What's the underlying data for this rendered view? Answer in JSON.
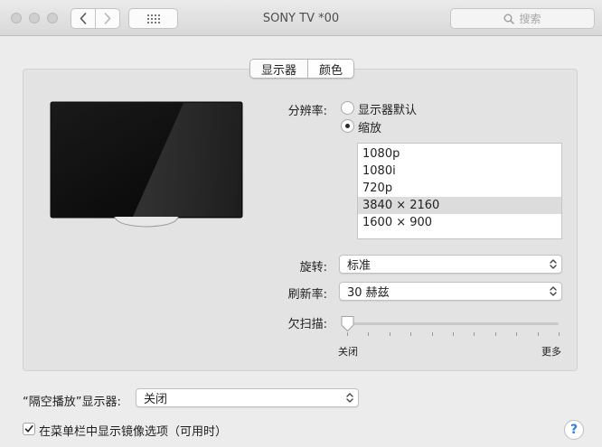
{
  "window": {
    "title": "SONY TV  *00",
    "search_placeholder": "搜索"
  },
  "tabs": [
    {
      "label": "显示器",
      "selected": true
    },
    {
      "label": "颜色",
      "selected": false
    }
  ],
  "resolution": {
    "label": "分辨率:",
    "options": [
      {
        "label": "显示器默认",
        "checked": false
      },
      {
        "label": "缩放",
        "checked": true
      }
    ],
    "list": [
      "1080p",
      "1080i",
      "720p",
      "3840 × 2160",
      "1600 × 900"
    ],
    "selected": "3840 × 2160"
  },
  "rotation": {
    "label": "旋转:",
    "value": "标准"
  },
  "refresh": {
    "label": "刷新率:",
    "value": "30 赫兹"
  },
  "underscan": {
    "label": "欠扫描:",
    "min_label": "关闭",
    "max_label": "更多",
    "value_fraction": 0
  },
  "airplay": {
    "label": "“隔空播放”显示器:",
    "value": "关闭"
  },
  "mirror_checkbox": {
    "label": "在菜单栏中显示镜像选项（可用时）",
    "checked": true
  },
  "help": {
    "label": "?"
  }
}
